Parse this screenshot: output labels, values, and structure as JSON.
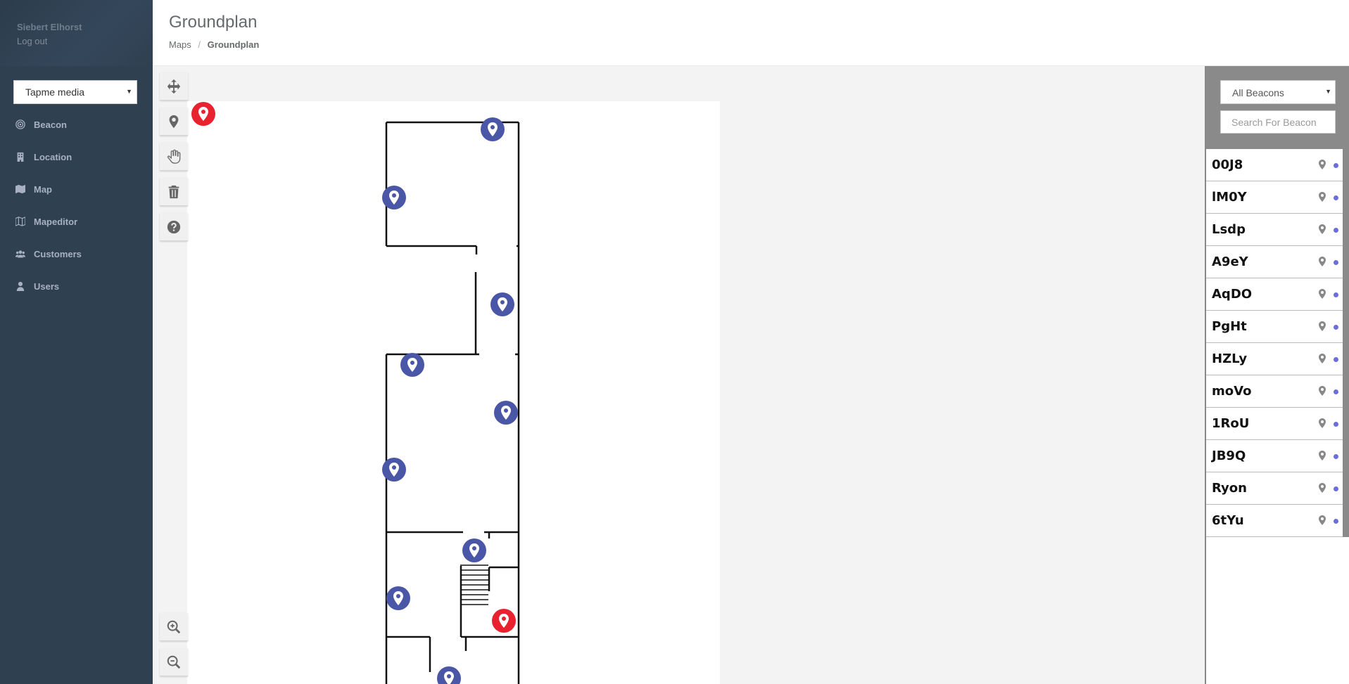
{
  "user": {
    "name": "Siebert Elhorst",
    "logout": "Log out"
  },
  "customer_select": {
    "value": "Tapme media"
  },
  "nav": [
    {
      "label": "Beacon"
    },
    {
      "label": "Location"
    },
    {
      "label": "Map"
    },
    {
      "label": "Mapeditor"
    },
    {
      "label": "Customers"
    },
    {
      "label": "Users"
    }
  ],
  "header": {
    "title": "Groundplan",
    "breadcrumb": {
      "parent": "Maps",
      "separator": "/",
      "current": "Groundplan"
    }
  },
  "tools": [
    "move-icon",
    "marker-icon",
    "hand-icon",
    "trash-icon",
    "help-icon",
    "zoom-in-icon",
    "zoom-out-icon"
  ],
  "beacon_filter": {
    "value": "All Beacons",
    "search_placeholder": "Search For Beacon"
  },
  "beacons": [
    {
      "name": "00J8"
    },
    {
      "name": "lM0Y"
    },
    {
      "name": "Lsdp"
    },
    {
      "name": "A9eY"
    },
    {
      "name": "AqDO"
    },
    {
      "name": "PgHt"
    },
    {
      "name": "HZLy"
    },
    {
      "name": "moVo"
    },
    {
      "name": "1RoU"
    },
    {
      "name": "JB9Q"
    },
    {
      "name": "Ryon"
    },
    {
      "name": "6tYu"
    }
  ],
  "colors": {
    "sidebar": "#2f4050",
    "marker_placed": "#4a56a6",
    "marker_unplaced": "#e8222f",
    "beacon_dot": "#6c6fd8"
  }
}
